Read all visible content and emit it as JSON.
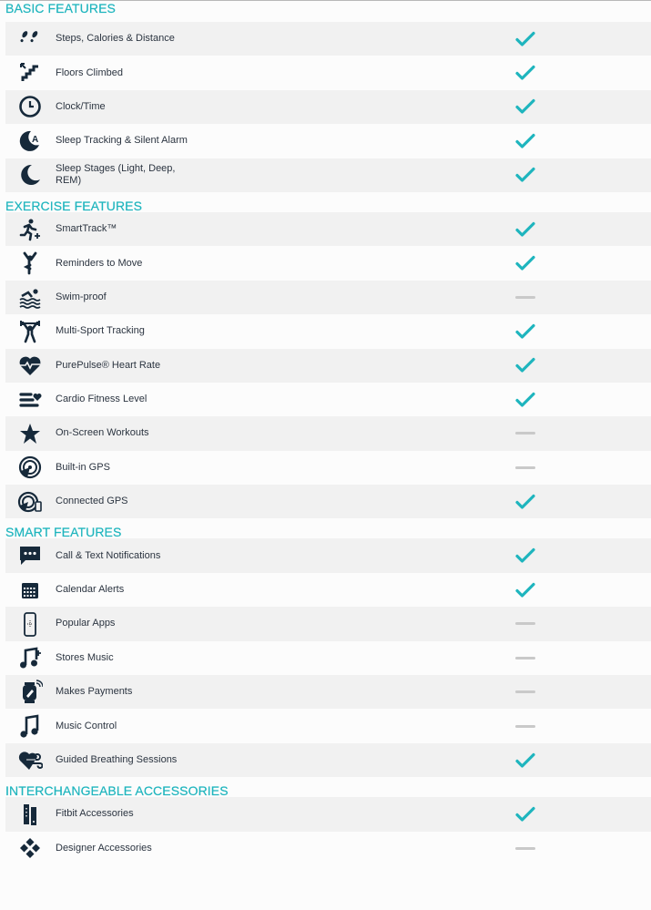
{
  "colors": {
    "accent": "#1fb5be",
    "icon": "#16293a",
    "text": "#2b3440",
    "dash": "#c9c9c9"
  },
  "sections": [
    {
      "title": "BASIC FEATURES",
      "items": [
        {
          "label": "Steps, Calories & Distance",
          "icon": "footsteps-icon",
          "supported": true,
          "status": "check"
        },
        {
          "label": "Floors Climbed",
          "icon": "stairs-icon",
          "supported": true,
          "status": "check"
        },
        {
          "label": "Clock/Time",
          "icon": "clock-icon",
          "supported": true,
          "status": "check"
        },
        {
          "label": "Sleep Tracking & Silent Alarm",
          "icon": "moon-alarm-icon",
          "supported": true,
          "status": "check"
        },
        {
          "label": "Sleep Stages (Light, Deep, REM)",
          "icon": "moon-icon",
          "supported": true,
          "status": "check"
        }
      ]
    },
    {
      "title": "EXERCISE FEATURES",
      "items": [
        {
          "label": "SmartTrack™",
          "icon": "runner-plus-icon",
          "supported": true,
          "status": "check"
        },
        {
          "label": "Reminders to Move",
          "icon": "person-stretch-icon",
          "supported": true,
          "status": "check"
        },
        {
          "label": "Swim-proof",
          "icon": "swimmer-icon",
          "supported": false,
          "status": "dash"
        },
        {
          "label": "Multi-Sport Tracking",
          "icon": "weightlifter-icon",
          "supported": true,
          "status": "check"
        },
        {
          "label": "PurePulse® Heart Rate",
          "icon": "heart-pulse-icon",
          "supported": true,
          "status": "check"
        },
        {
          "label": "Cardio Fitness Level",
          "icon": "bars-heart-icon",
          "supported": true,
          "status": "check"
        },
        {
          "label": "On-Screen Workouts",
          "icon": "star-icon",
          "supported": false,
          "status": "dash"
        },
        {
          "label": "Built-in GPS",
          "icon": "gps-icon",
          "supported": false,
          "status": "dash"
        },
        {
          "label": "Connected GPS",
          "icon": "gps-phone-icon",
          "supported": true,
          "status": "check"
        }
      ]
    },
    {
      "title": "SMART FEATURES",
      "items": [
        {
          "label": "Call & Text Notifications",
          "icon": "chat-bubble-icon",
          "supported": true,
          "status": "check"
        },
        {
          "label": "Calendar Alerts",
          "icon": "calendar-icon",
          "supported": true,
          "status": "check"
        },
        {
          "label": "Popular Apps",
          "icon": "phone-app-icon",
          "supported": false,
          "status": "dash"
        },
        {
          "label": "Stores Music",
          "icon": "music-plus-icon",
          "supported": false,
          "status": "dash"
        },
        {
          "label": "Makes Payments",
          "icon": "watch-payment-icon",
          "supported": false,
          "status": "dash"
        },
        {
          "label": "Music Control",
          "icon": "music-note-icon",
          "supported": false,
          "status": "dash"
        },
        {
          "label": "Guided Breathing Sessions",
          "icon": "heart-wind-icon",
          "supported": true,
          "status": "check"
        }
      ]
    },
    {
      "title": "INTERCHANGEABLE ACCESSORIES",
      "items": [
        {
          "label": "Fitbit Accessories",
          "icon": "bands-icon",
          "supported": true,
          "status": "check"
        },
        {
          "label": "Designer Accessories",
          "icon": "diamond-icon",
          "supported": false,
          "status": "dash"
        }
      ]
    }
  ]
}
